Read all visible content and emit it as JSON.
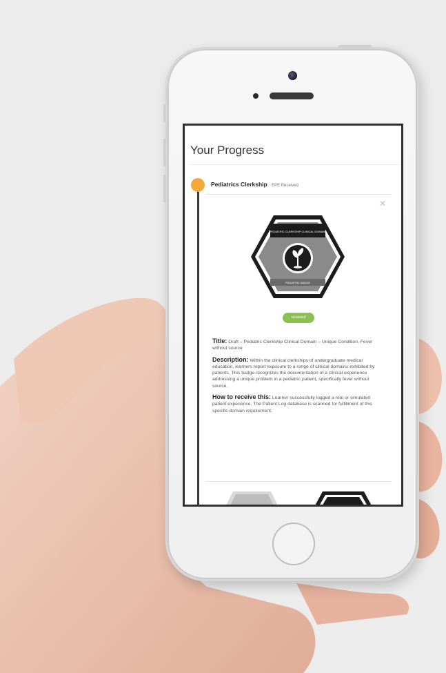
{
  "screen": {
    "page_title": "Your Progress",
    "course": {
      "name": "Pediatrics Clerkship",
      "sub": "EPE Received"
    },
    "close_glyph": "✕",
    "badge": {
      "top_text": "PEDIATRIC CLERKSHIP CLINICAL DOMAIN",
      "bottom_text": "PEDIATRIC BADGE",
      "icon": "seedling-icon"
    },
    "status": "received",
    "details": {
      "title_label": "Title:",
      "title_value": "Draft – Pediatric Clerkship Clinical Domain – Unique Condition, Fever without source",
      "description_label": "Description:",
      "description_value": "Within the clinical clerkships of undergraduate medical education, learners report exposure to a range of clinical domains exhibited by patients. This badge recognizes the documentation of a clinical experience addressing a unique problem in a pediatric patient, specifically fever without source.",
      "how_label": "How to receive this:",
      "how_value": "Learner successfully logged a real or simulated patient experience. The Patient Log database is scanned for fulfillment of this specific domain requirement."
    }
  },
  "colors": {
    "accent_orange": "#f2a93b",
    "received_green": "#8cc152",
    "badge_gray": "#8a8a8a",
    "badge_dark": "#1c1c1c"
  }
}
